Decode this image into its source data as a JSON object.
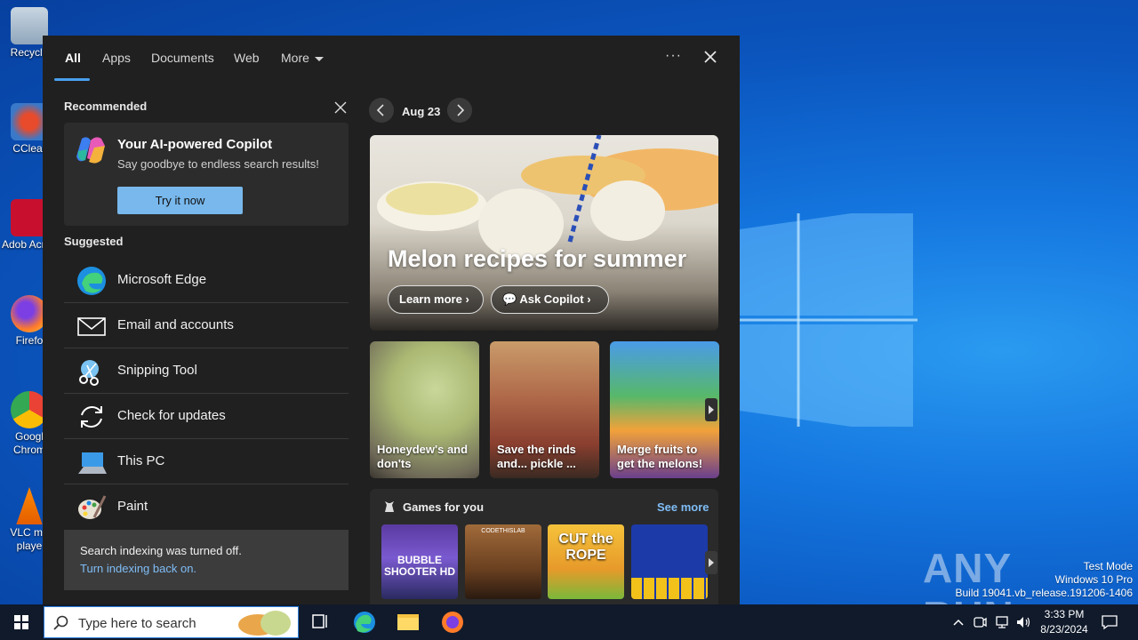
{
  "desktop": {
    "icons": [
      {
        "label": "Recycle"
      },
      {
        "label": "CClear"
      },
      {
        "label": "Adob Acrob"
      },
      {
        "label": "Firefo"
      },
      {
        "label": "Googl Chrom"
      },
      {
        "label": "VLC me playe"
      }
    ],
    "watermark": {
      "brand": "ANY RUN"
    },
    "os_info": {
      "line1": "Test Mode",
      "line2": "Windows 10 Pro",
      "line3": "Build 19041.vb_release.191206-1406"
    }
  },
  "search_panel": {
    "tabs": [
      {
        "label": "All"
      },
      {
        "label": "Apps"
      },
      {
        "label": "Documents"
      },
      {
        "label": "Web"
      },
      {
        "label": "More"
      }
    ],
    "dots_label": "···",
    "recommended": {
      "title": "Recommended",
      "card": {
        "title": "Your AI-powered Copilot",
        "subtitle": "Say goodbye to endless search results!",
        "button": "Try it now"
      }
    },
    "suggested": {
      "title": "Suggested",
      "items": [
        {
          "label": "Microsoft Edge",
          "icon": "edge-icon"
        },
        {
          "label": "Email and accounts",
          "icon": "mail-icon"
        },
        {
          "label": "Snipping Tool",
          "icon": "snipping-tool-icon"
        },
        {
          "label": "Check for updates",
          "icon": "sync-icon"
        },
        {
          "label": "This PC",
          "icon": "computer-icon"
        },
        {
          "label": "Paint",
          "icon": "paint-icon"
        }
      ]
    },
    "indexing": {
      "text": "Search indexing was turned off.",
      "link": "Turn indexing back on."
    },
    "highlights": {
      "date": "Aug 23",
      "hero": {
        "title": "Melon recipes for summer",
        "learn_more": "Learn more",
        "ask_copilot": "Ask Copilot"
      },
      "cards": [
        {
          "title": "Honeydew's and don'ts"
        },
        {
          "title": "Save the rinds and... pickle ..."
        },
        {
          "title": "Merge fruits to get the melons!"
        }
      ],
      "games": {
        "title": "Games for you",
        "see_more": "See more",
        "items": [
          {
            "label": "BUBBLE SHOOTER HD"
          },
          {
            "label": "CODETHISLAB"
          },
          {
            "label": "CUT the ROPE"
          },
          {
            "label": "blocks"
          }
        ]
      }
    }
  },
  "taskbar": {
    "search_placeholder": "Type here to search",
    "time": "3:33 PM",
    "date": "8/23/2024"
  }
}
